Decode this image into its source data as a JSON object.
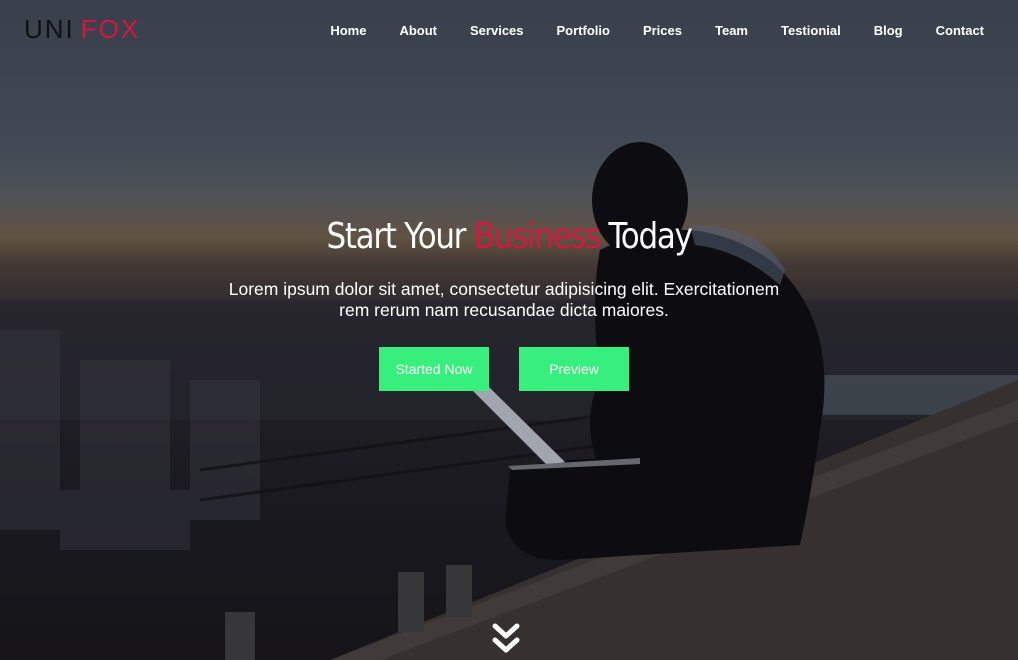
{
  "brand": {
    "part1": "UNI",
    "part2": "FOX",
    "accent_color": "#d4173f"
  },
  "nav": {
    "items": [
      {
        "label": "Home"
      },
      {
        "label": "About"
      },
      {
        "label": "Services"
      },
      {
        "label": "Portfolio"
      },
      {
        "label": "Prices"
      },
      {
        "label": "Team"
      },
      {
        "label": "Testionial"
      },
      {
        "label": "Blog"
      },
      {
        "label": "Contact"
      }
    ]
  },
  "hero": {
    "headline_pre": "Start Your",
    "headline_accent": "Business",
    "headline_post": "Today",
    "subtext_line1": "Lorem ipsum dolor sit amet, consectetur adipisicing elit. Exercitationem",
    "subtext_line2": "rem rerum nam recusandae dicta maiores.",
    "primary_button": "Started Now",
    "secondary_button": "Preview",
    "button_color": "#37ef7c"
  },
  "icons": {
    "scroll": "double-chevron-down-icon"
  }
}
